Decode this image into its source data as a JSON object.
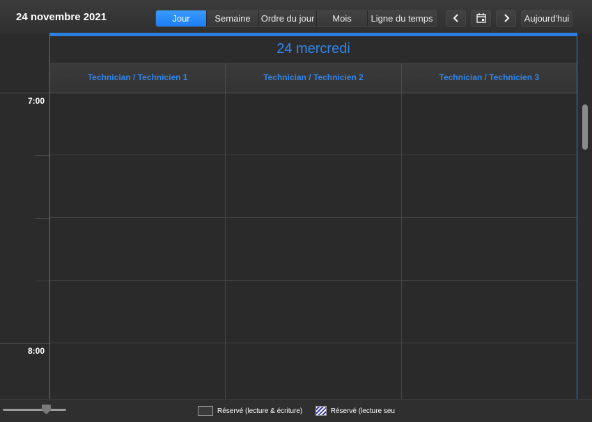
{
  "toolbar": {
    "date_title": "24 novembre 2021",
    "views": [
      {
        "label": "Jour",
        "active": true
      },
      {
        "label": "Semaine",
        "active": false
      },
      {
        "label": "Ordre du jour",
        "active": false
      },
      {
        "label": "Mois",
        "active": false
      },
      {
        "label": "Ligne du temps",
        "active": false
      }
    ],
    "prev_icon": "chevron-left-icon",
    "calendar_icon": "calendar-icon",
    "next_icon": "chevron-right-icon",
    "today_label": "Aujourd'hui"
  },
  "day": {
    "header": "24 mercredi",
    "resources": [
      "Technician / Technicien 1",
      "Technician / Technicien 2",
      "Technician / Technicien 3"
    ]
  },
  "time_gutter": {
    "hours": [
      "7:00",
      "8:00"
    ]
  },
  "footer": {
    "legend": [
      {
        "label": "Réservé (lecture & écriture)",
        "style": "solid"
      },
      {
        "label": "Réservé (lecture seu",
        "style": "hatched"
      }
    ]
  },
  "colors": {
    "accent": "#2d7fe0",
    "active_view": "#1d7df5",
    "background": "#2b2b2b"
  }
}
